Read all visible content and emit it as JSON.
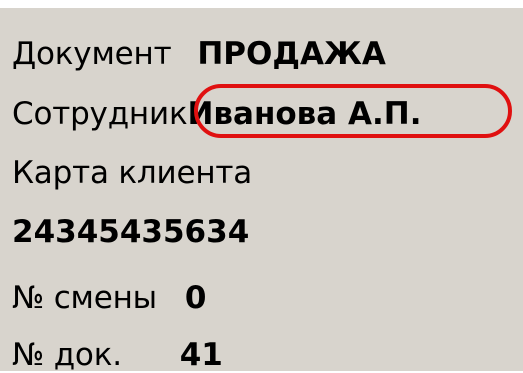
{
  "document": {
    "label": "Документ",
    "value": "ПРОДАЖА"
  },
  "employee": {
    "label": "Сотрудник",
    "value": "Иванова А.П."
  },
  "client_card": {
    "label": "Карта клиента",
    "value": "24345435634"
  },
  "shift": {
    "label": "№ смены",
    "value": "0"
  },
  "doc_number": {
    "label": "№ док.",
    "value": "41"
  },
  "colors": {
    "panel_background": "#d8d4cd",
    "highlight_outline": "#e01010",
    "text": "#000000"
  }
}
